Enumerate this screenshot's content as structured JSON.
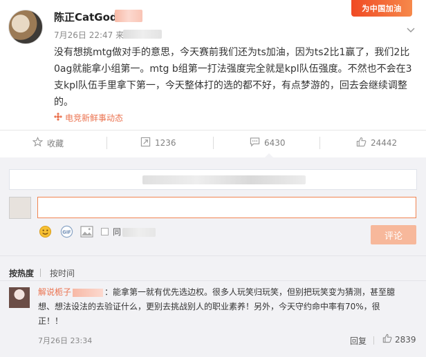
{
  "post": {
    "author": "陈正CatGod",
    "timestamp": "7月26日 22:47",
    "source_prefix": "来",
    "badge": "为中国加油",
    "content": "没有想挑mtg做对手的意思，今天赛前我们还为ts加油，因为ts2比1赢了，我们2比0ag就能拿小组第一。mtg b组第一打法强度完全就是kpl队伍强度。不然也不会在3支kpl队伍手里拿下第一，今天整体打的选的都不好，有点梦游的，回去会继续调整的。",
    "topic": "电竞新鲜事动态",
    "actions": {
      "favorite": "收藏",
      "repost_count": "1236",
      "comment_count": "6430",
      "like_count": "24442"
    }
  },
  "comment_form": {
    "input_value": "",
    "same_repost_label": "同",
    "submit_label": "评论"
  },
  "sort_tabs": {
    "hot": "按热度",
    "time": "按时间"
  },
  "comments": [
    {
      "user": "解说栀子",
      "separator": "：",
      "text_line1": "能拿第一就有优先选边权。很多人玩笑归玩笑，但别把玩笑变为猜测，甚至臆",
      "text_line2": "想、想法设法的去验证什么，更别去挑战别人的职业素养！另外，今天守约命中率有70%，很",
      "text_line3": "正！！",
      "time": "7月26日 23:34",
      "reply_label": "回复",
      "like_count": "2839"
    }
  ],
  "colors": {
    "accent": "#eb7350",
    "submit_disabled": "#f7b89b",
    "panel_bg": "#f2f2f5",
    "badge_start": "#f04a24"
  }
}
